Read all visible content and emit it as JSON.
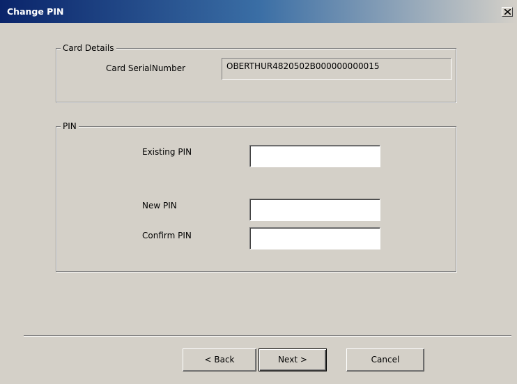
{
  "window": {
    "title": "Change PIN"
  },
  "card_details": {
    "legend": "Card Details",
    "serial_label": "Card SerialNumber",
    "serial_value": "OBERTHUR4820502B000000000015"
  },
  "pin": {
    "legend": "PIN",
    "existing_label": "Existing PIN",
    "existing_value": "",
    "new_label": "New PIN",
    "new_value": "",
    "confirm_label": "Confirm PIN",
    "confirm_value": ""
  },
  "buttons": {
    "back": "< Back",
    "next": "Next >",
    "cancel": "Cancel"
  },
  "icons": {
    "close": "close-icon"
  }
}
